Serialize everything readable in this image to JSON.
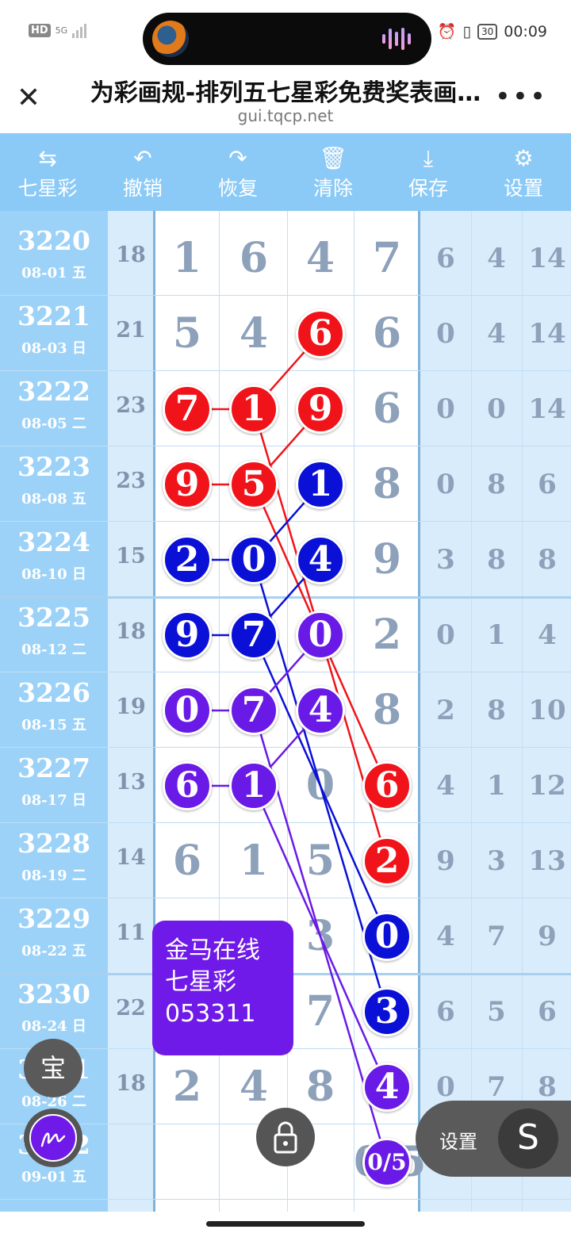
{
  "status": {
    "hd": "HD",
    "network": "5G",
    "battery": "30",
    "time": "00:09"
  },
  "browser": {
    "title": "为彩画规-排列五七星彩免费奖表画…",
    "url": "gui.tqcp.net"
  },
  "toolbar": [
    {
      "icon": "swap-icon",
      "glyph": "⇆",
      "label": "七星彩"
    },
    {
      "icon": "undo-icon",
      "glyph": "↶",
      "label": "撤销"
    },
    {
      "icon": "redo-icon",
      "glyph": "↷",
      "label": "恢复"
    },
    {
      "icon": "trash-icon",
      "glyph": "🗑",
      "label": "清除"
    },
    {
      "icon": "download-icon",
      "glyph": "⤓",
      "label": "保存"
    },
    {
      "icon": "gear-icon",
      "glyph": "⚙",
      "label": "设置"
    }
  ],
  "rows": [
    {
      "period": "3220",
      "date": "08-01 五",
      "sum": "18",
      "digits": [
        "1",
        "6",
        "4",
        "7"
      ],
      "right": [
        "6",
        "4",
        "14"
      ]
    },
    {
      "period": "3221",
      "date": "08-03 日",
      "sum": "21",
      "digits": [
        "5",
        "4",
        "6",
        "6"
      ],
      "right": [
        "0",
        "4",
        "14"
      ]
    },
    {
      "period": "3222",
      "date": "08-05 二",
      "sum": "23",
      "digits": [
        "7",
        "1",
        "9",
        "6"
      ],
      "right": [
        "0",
        "0",
        "14"
      ]
    },
    {
      "period": "3223",
      "date": "08-08 五",
      "sum": "23",
      "digits": [
        "9",
        "5",
        "1",
        "8"
      ],
      "right": [
        "0",
        "8",
        "6"
      ]
    },
    {
      "period": "3224",
      "date": "08-10 日",
      "sum": "15",
      "digits": [
        "2",
        "0",
        "4",
        "9"
      ],
      "right": [
        "3",
        "8",
        "8"
      ]
    },
    {
      "period": "3225",
      "date": "08-12 二",
      "sum": "18",
      "digits": [
        "9",
        "7",
        "0",
        "2"
      ],
      "right": [
        "0",
        "1",
        "4"
      ]
    },
    {
      "period": "3226",
      "date": "08-15 五",
      "sum": "19",
      "digits": [
        "0",
        "7",
        "4",
        "8"
      ],
      "right": [
        "2",
        "8",
        "10"
      ]
    },
    {
      "period": "3227",
      "date": "08-17 日",
      "sum": "13",
      "digits": [
        "6",
        "1",
        "0",
        "6"
      ],
      "right": [
        "4",
        "1",
        "12"
      ]
    },
    {
      "period": "3228",
      "date": "08-19 二",
      "sum": "14",
      "digits": [
        "6",
        "1",
        "5",
        "2"
      ],
      "right": [
        "9",
        "3",
        "13"
      ]
    },
    {
      "period": "3229",
      "date": "08-22 五",
      "sum": "11",
      "digits": [
        "",
        "",
        "3",
        "0"
      ],
      "right": [
        "4",
        "7",
        "9"
      ]
    },
    {
      "period": "3230",
      "date": "08-24 日",
      "sum": "22",
      "digits": [
        "",
        "",
        "7",
        "3"
      ],
      "right": [
        "6",
        "5",
        "6"
      ]
    },
    {
      "period": "3231",
      "date": "08-26 二",
      "sum": "18",
      "digits": [
        "2",
        "4",
        "8",
        "4"
      ],
      "right": [
        "0",
        "7",
        "8"
      ]
    },
    {
      "period": "3232",
      "date": "09-01 五",
      "sum": "",
      "digits": [
        "",
        "",
        "",
        "0/5"
      ],
      "right": [
        "",
        "",
        ""
      ]
    }
  ],
  "colors": {
    "red": "#f0141a",
    "blue": "#0a10d6",
    "purple": "#6a1ae6"
  },
  "balls": [
    {
      "row": 1,
      "col": 2,
      "color": "red"
    },
    {
      "row": 2,
      "col": 0,
      "color": "red"
    },
    {
      "row": 2,
      "col": 1,
      "color": "red"
    },
    {
      "row": 2,
      "col": 2,
      "color": "red"
    },
    {
      "row": 3,
      "col": 0,
      "color": "red"
    },
    {
      "row": 3,
      "col": 1,
      "color": "red"
    },
    {
      "row": 3,
      "col": 2,
      "color": "blue"
    },
    {
      "row": 4,
      "col": 0,
      "color": "blue"
    },
    {
      "row": 4,
      "col": 1,
      "color": "blue"
    },
    {
      "row": 4,
      "col": 2,
      "color": "blue"
    },
    {
      "row": 5,
      "col": 0,
      "color": "blue"
    },
    {
      "row": 5,
      "col": 1,
      "color": "blue"
    },
    {
      "row": 5,
      "col": 2,
      "color": "purple"
    },
    {
      "row": 6,
      "col": 0,
      "color": "purple"
    },
    {
      "row": 6,
      "col": 1,
      "color": "purple"
    },
    {
      "row": 6,
      "col": 2,
      "color": "purple"
    },
    {
      "row": 7,
      "col": 0,
      "color": "purple"
    },
    {
      "row": 7,
      "col": 1,
      "color": "purple"
    },
    {
      "row": 7,
      "col": 3,
      "color": "red"
    },
    {
      "row": 8,
      "col": 3,
      "color": "red"
    },
    {
      "row": 9,
      "col": 3,
      "color": "blue"
    },
    {
      "row": 10,
      "col": 3,
      "color": "blue"
    },
    {
      "row": 11,
      "col": 3,
      "color": "purple"
    },
    {
      "row": 12,
      "col": 3,
      "color": "purple"
    }
  ],
  "links": [
    {
      "from": [
        1,
        2
      ],
      "to": [
        2,
        1
      ],
      "color": "red"
    },
    {
      "from": [
        2,
        0
      ],
      "to": [
        2,
        1
      ],
      "color": "red"
    },
    {
      "from": [
        2,
        1
      ],
      "to": [
        8,
        3
      ],
      "color": "red"
    },
    {
      "from": [
        2,
        2
      ],
      "to": [
        3,
        1
      ],
      "color": "red"
    },
    {
      "from": [
        3,
        0
      ],
      "to": [
        3,
        1
      ],
      "color": "red"
    },
    {
      "from": [
        3,
        1
      ],
      "to": [
        7,
        3
      ],
      "color": "red"
    },
    {
      "from": [
        3,
        2
      ],
      "to": [
        4,
        1
      ],
      "color": "blue"
    },
    {
      "from": [
        4,
        0
      ],
      "to": [
        4,
        1
      ],
      "color": "blue"
    },
    {
      "from": [
        4,
        1
      ],
      "to": [
        10,
        3
      ],
      "color": "blue"
    },
    {
      "from": [
        4,
        2
      ],
      "to": [
        5,
        1
      ],
      "color": "blue"
    },
    {
      "from": [
        5,
        0
      ],
      "to": [
        5,
        1
      ],
      "color": "blue"
    },
    {
      "from": [
        5,
        1
      ],
      "to": [
        9,
        3
      ],
      "color": "blue"
    },
    {
      "from": [
        5,
        2
      ],
      "to": [
        6,
        1
      ],
      "color": "purple"
    },
    {
      "from": [
        6,
        0
      ],
      "to": [
        6,
        1
      ],
      "color": "purple"
    },
    {
      "from": [
        6,
        1
      ],
      "to": [
        12,
        3
      ],
      "color": "purple"
    },
    {
      "from": [
        6,
        2
      ],
      "to": [
        7,
        1
      ],
      "color": "purple"
    },
    {
      "from": [
        7,
        0
      ],
      "to": [
        7,
        1
      ],
      "color": "purple"
    },
    {
      "from": [
        7,
        1
      ],
      "to": [
        11,
        3
      ],
      "color": "purple"
    }
  ],
  "note": {
    "line1": "金马在线",
    "line2": "七星彩",
    "line3": "053311"
  },
  "fab": {
    "bao": "宝",
    "settings_label": "设置",
    "s_button": "S"
  }
}
